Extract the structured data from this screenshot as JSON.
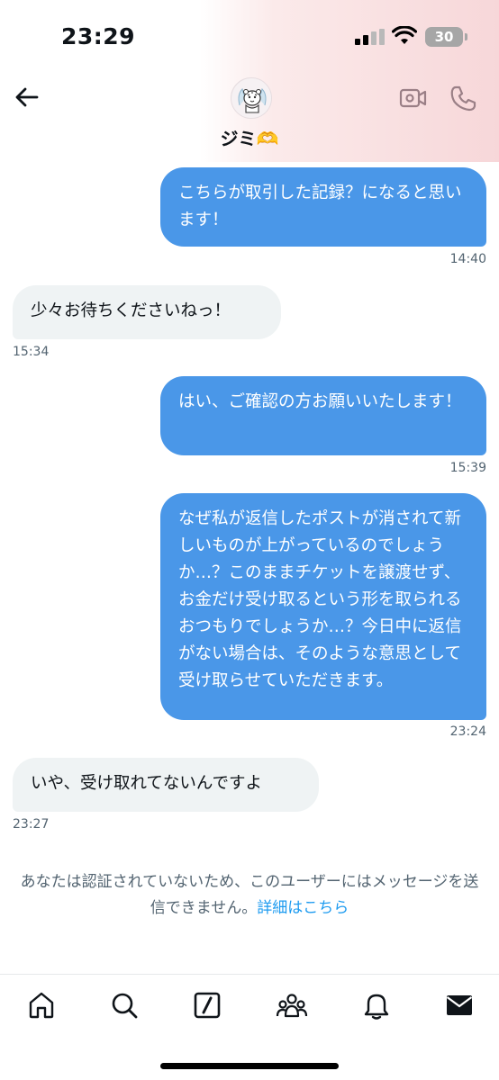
{
  "status_bar": {
    "time": "23:29",
    "battery_level": "30"
  },
  "header": {
    "contact_name": "ジミ🫶",
    "back_icon": "arrow-left-icon",
    "video_call_icon": "video-camera-icon",
    "phone_icon": "phone-icon"
  },
  "messages": [
    {
      "direction": "sent",
      "text": "こちらが取引した記録？になると思います！",
      "time": "14:40"
    },
    {
      "direction": "received",
      "text": "少々お待ちくださいねっ！",
      "time": "15:34"
    },
    {
      "direction": "sent",
      "text": "はい、ご確認の方お願いいたします！",
      "time": "15:39"
    },
    {
      "direction": "sent",
      "text": "なぜ私が返信したポストが消されて新しいものが上がっているのでしょうか…？このままチケットを譲渡せず、お金だけ受け取るという形を取られるおつもりでしょうか…？今日中に返信がない場合は、そのような意思として受け取らせていただきます。",
      "time": "23:24"
    },
    {
      "direction": "received",
      "text": "いや、受け取れてないんですよ",
      "time": "23:27"
    }
  ],
  "notice": {
    "text": "あなたは認証されていないため、このユーザーにはメッセージを送信できません。",
    "link_text": "詳細はこちら"
  },
  "tab_bar": [
    {
      "name": "home",
      "icon": "home-icon"
    },
    {
      "name": "search",
      "icon": "search-icon"
    },
    {
      "name": "grok",
      "icon": "slash-square-icon"
    },
    {
      "name": "communities",
      "icon": "people-icon"
    },
    {
      "name": "notifications",
      "icon": "bell-icon"
    },
    {
      "name": "messages",
      "icon": "envelope-icon",
      "active": true
    }
  ],
  "colors": {
    "sent_bubble": "#4a97e8",
    "received_bubble": "#eff3f4",
    "link": "#1d9bf0",
    "muted_text": "#536471",
    "header_gradient_end": "#f7d7d9"
  }
}
